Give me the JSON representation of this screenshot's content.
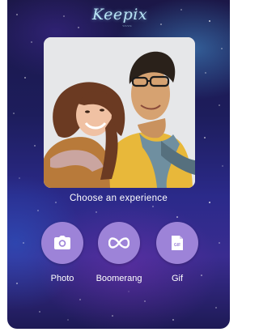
{
  "brand": {
    "logo_text": "Keepix",
    "logo_subtext": "~~~~"
  },
  "photo": {
    "description_icon": "couple-photo"
  },
  "experience": {
    "prompt": "Choose an experience",
    "options": [
      {
        "label": "Photo",
        "icon": "camera-icon"
      },
      {
        "label": "Boomerang",
        "icon": "infinity-icon"
      },
      {
        "label": "Gif",
        "icon": "gif-file-icon"
      }
    ]
  },
  "colors": {
    "button": "#9d83d8",
    "text": "#ffffff",
    "logo": "#b9e4f5"
  }
}
